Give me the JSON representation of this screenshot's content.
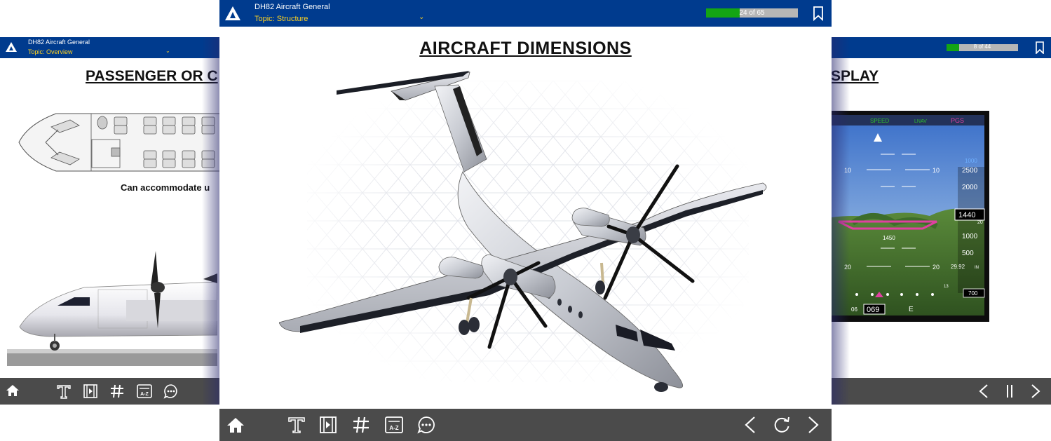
{
  "left_card": {
    "course_title": "DH82 Aircraft General",
    "topic": "Topic: Overview",
    "page_title": "PASSENGER OR C",
    "caption": "Can accommodate u"
  },
  "main_card": {
    "course_title": "DH82 Aircraft General",
    "topic": "Topic: Structure",
    "progress": {
      "text": "24 of 65",
      "current": 24,
      "total": 65
    },
    "page_title": "AIRCRAFT DIMENSIONS",
    "figure": "aircraft-isometric-illustration"
  },
  "right_card": {
    "page_title": "SPLAY",
    "progress": {
      "text": "8 of 44",
      "current": 8,
      "total": 44
    },
    "pfd": {
      "top_labels": [
        "SPEED",
        "LNAV",
        "PGS"
      ],
      "speed_tape": [
        "2500",
        "2000",
        "1500",
        "1000",
        "500"
      ],
      "altitude_box": "1440",
      "altitude_sub": "20",
      "baro": "29.92",
      "baro_unit": "IN",
      "heading": "069",
      "heading_tick": "06",
      "heading_letter": "E",
      "alt_small": "1450",
      "vs_box": "700",
      "pitch_10": "10",
      "pitch_20": "20",
      "alt_top": "1000",
      "misc": "13"
    }
  },
  "icons": {
    "logo": "aircraft-logo-icon",
    "home": "home-icon",
    "text": "text-icon",
    "video": "video-icon",
    "number": "hash-icon",
    "glossary": "glossary-az-icon",
    "chat": "chat-icon",
    "prev": "chevron-left-icon",
    "reload": "reload-icon",
    "next": "chevron-right-icon",
    "pause": "pause-icon",
    "bookmark": "bookmark-icon"
  },
  "colors": {
    "header_bg": "#003b8e",
    "topic_text": "#ffd21f",
    "footer_bg": "#4b4b4b",
    "progress_fill": "#14a514",
    "progress_track": "#b6b6b6"
  }
}
